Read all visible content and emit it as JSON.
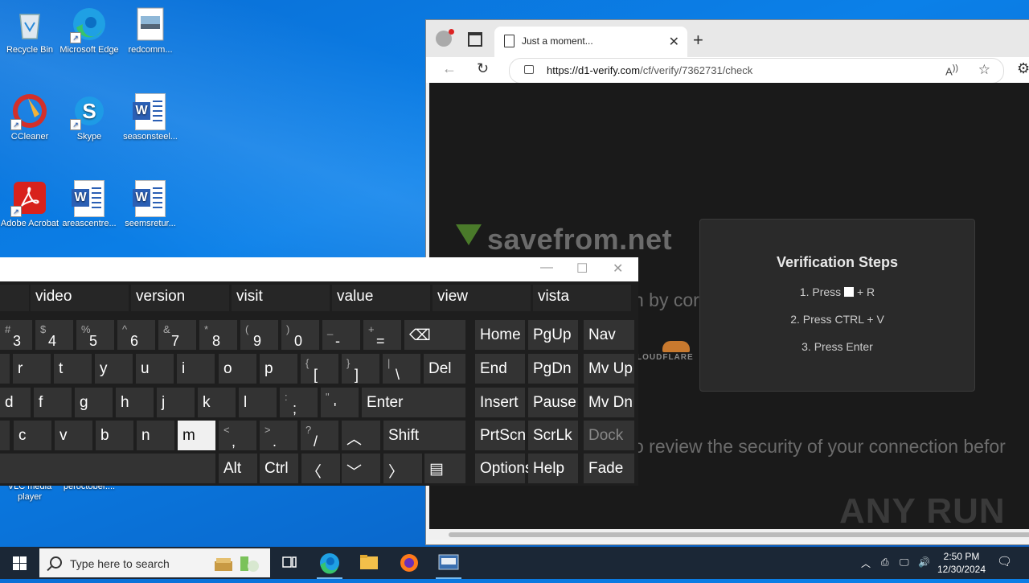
{
  "desktop": {
    "icons": [
      {
        "label": "Recycle Bin"
      },
      {
        "label": "Microsoft Edge"
      },
      {
        "label": "redcomm..."
      },
      {
        "label": "CCleaner"
      },
      {
        "label": "Skype"
      },
      {
        "label": "seasonsteel..."
      },
      {
        "label": "Adobe Acrobat"
      },
      {
        "label": "areascentre..."
      },
      {
        "label": "seemsretur..."
      },
      {
        "label": "VLC media player"
      },
      {
        "label": "peroctober...."
      }
    ]
  },
  "browser": {
    "tab_title": "Just a moment...",
    "url_host": "https://d1-verify.com",
    "url_path": "/cf/verify/7362731/check",
    "page": {
      "brand": "savefrom.net",
      "by_text": "n by cor",
      "cloudflare_text": "LOUDFLARE",
      "review_text": "o review the security of your connection befor",
      "verification": {
        "heading": "Verification Steps",
        "step1_pre": "1. Press",
        "step1_post": "+ R",
        "step2": "2. Press CTRL + V",
        "step3": "3. Press Enter"
      },
      "watermark": "ANY RUN"
    }
  },
  "osk": {
    "suggestions": [
      "video",
      "version",
      "visit",
      "value",
      "view",
      "vista"
    ],
    "row1": [
      {
        "sub": "#",
        "main": "3"
      },
      {
        "sub": "$",
        "main": "4"
      },
      {
        "sub": "%",
        "main": "5"
      },
      {
        "sub": "^",
        "main": "6"
      },
      {
        "sub": "&",
        "main": "7"
      },
      {
        "sub": "*",
        "main": "8"
      },
      {
        "sub": "(",
        "main": "9"
      },
      {
        "sub": ")",
        "main": "0"
      },
      {
        "sub": "_",
        "main": "-"
      },
      {
        "sub": "+",
        "main": "="
      }
    ],
    "row2": [
      "r",
      "t",
      "y",
      "u",
      "i",
      "o",
      "p"
    ],
    "row2_sym": [
      {
        "sub": "{",
        "main": "["
      },
      {
        "sub": "}",
        "main": "]"
      },
      {
        "sub": "|",
        "main": "\\"
      }
    ],
    "row3": [
      "d",
      "f",
      "g",
      "h",
      "j",
      "k",
      "l"
    ],
    "row3_sym": [
      {
        "sub": ":",
        "main": ";"
      },
      {
        "sub": "\"",
        "main": "'"
      }
    ],
    "row4": [
      "c",
      "v",
      "b",
      "n",
      "m"
    ],
    "row4_sym": [
      {
        "sub": "<",
        "main": ","
      },
      {
        "sub": ">",
        "main": "."
      },
      {
        "sub": "?",
        "main": "/"
      }
    ],
    "keys": {
      "del": "Del",
      "enter": "Enter",
      "shift": "Shift",
      "alt": "Alt",
      "ctrl": "Ctrl",
      "home": "Home",
      "pgup": "PgUp",
      "nav": "Nav",
      "end": "End",
      "pgdn": "PgDn",
      "mvup": "Mv Up",
      "insert": "Insert",
      "pause": "Pause",
      "mvdn": "Mv Dn",
      "prtscn": "PrtScn",
      "scrlk": "ScrLk",
      "dock": "Dock",
      "options": "Options",
      "help": "Help",
      "fade": "Fade"
    }
  },
  "taskbar": {
    "search_placeholder": "Type here to search",
    "time": "2:50 PM",
    "date": "12/30/2024"
  }
}
